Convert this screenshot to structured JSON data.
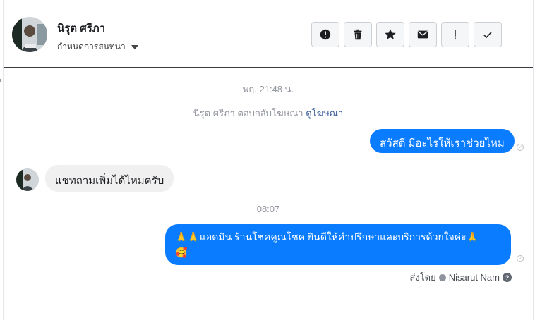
{
  "header": {
    "contact_name": "นิรุต ศรีภา",
    "assign_label": "กำหนดการสนทนา"
  },
  "toolbar": {
    "buttons": [
      {
        "icon": "alert-circle-icon"
      },
      {
        "icon": "trash-icon"
      },
      {
        "icon": "star-icon"
      },
      {
        "icon": "envelope-icon"
      },
      {
        "icon": "exclamation-icon"
      },
      {
        "icon": "checkmark-icon"
      }
    ]
  },
  "conversation": {
    "timestamp_1": "พฤ. 21:48 น.",
    "system_message_prefix": "นิรุต ศรีภา ตอบกลับโฆษณา",
    "system_message_link": "ดูโฆษณา",
    "message_out_1": "สวัสดี มีอะไรให้เราช่วยไหม",
    "message_in_1": "แชทถามเพิ่มได้ไหมครับ",
    "timestamp_2": "08:07",
    "message_out_2_line1": "🙏🙏แอดมิน ร้านโชคคูณโชค ยินดีให้คำปรึกษาและบริการด้วยใจค่ะ🙏",
    "message_out_2_line2": "🥰",
    "sent_by_label": "ส่งโดย",
    "sent_by_name": "Nisarut Nam"
  },
  "colors": {
    "outgoing_bubble": "#0a7cff",
    "incoming_bubble": "#f0f0f0",
    "link": "#385898"
  }
}
